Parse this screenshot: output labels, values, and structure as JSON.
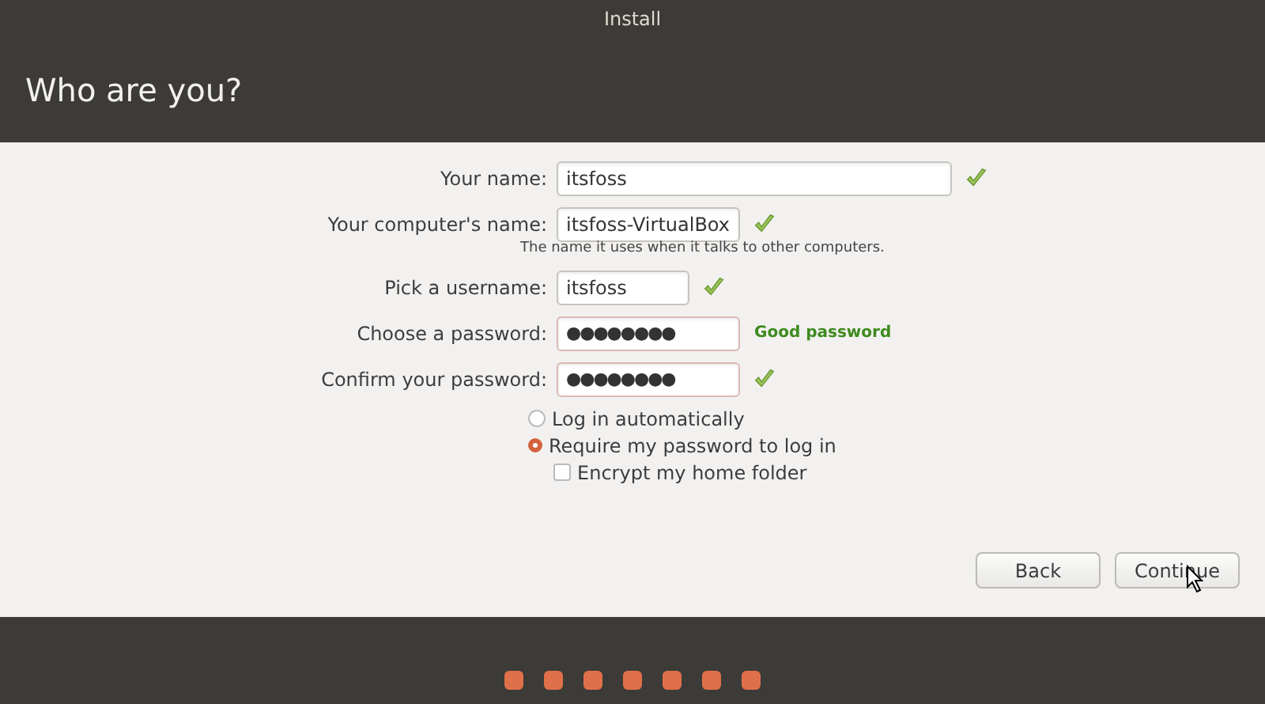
{
  "window": {
    "title": "Install"
  },
  "header": {
    "title": "Who are you?"
  },
  "fields": [
    {
      "label": "Your name:",
      "value": "itsfoss",
      "kind": "text",
      "valid": true
    },
    {
      "label": "Your computer's name:",
      "value": "itsfoss-VirtualBox",
      "kind": "text",
      "valid": true,
      "hint": "The name it uses when it talks to other computers."
    },
    {
      "label": "Pick a username:",
      "value": "itsfoss",
      "kind": "text",
      "valid": true
    },
    {
      "label": "Choose a password:",
      "value": "●●●●●●●●",
      "kind": "password",
      "valid": false,
      "status": "Good password"
    },
    {
      "label": "Confirm your password:",
      "value": "●●●●●●●●",
      "kind": "password",
      "valid": true
    }
  ],
  "login_options": [
    {
      "label": "Log in automatically",
      "selected": false
    },
    {
      "label": "Require my password to log in",
      "selected": true
    }
  ],
  "encrypt": {
    "label": "Encrypt my home folder",
    "checked": false
  },
  "buttons": [
    {
      "label": "Back"
    },
    {
      "label": "Continue"
    }
  ],
  "progress_steps": [
    {
      "done": true
    },
    {
      "done": true
    },
    {
      "done": true
    },
    {
      "done": true
    },
    {
      "done": true
    },
    {
      "done": true
    },
    {
      "done": true
    }
  ]
}
